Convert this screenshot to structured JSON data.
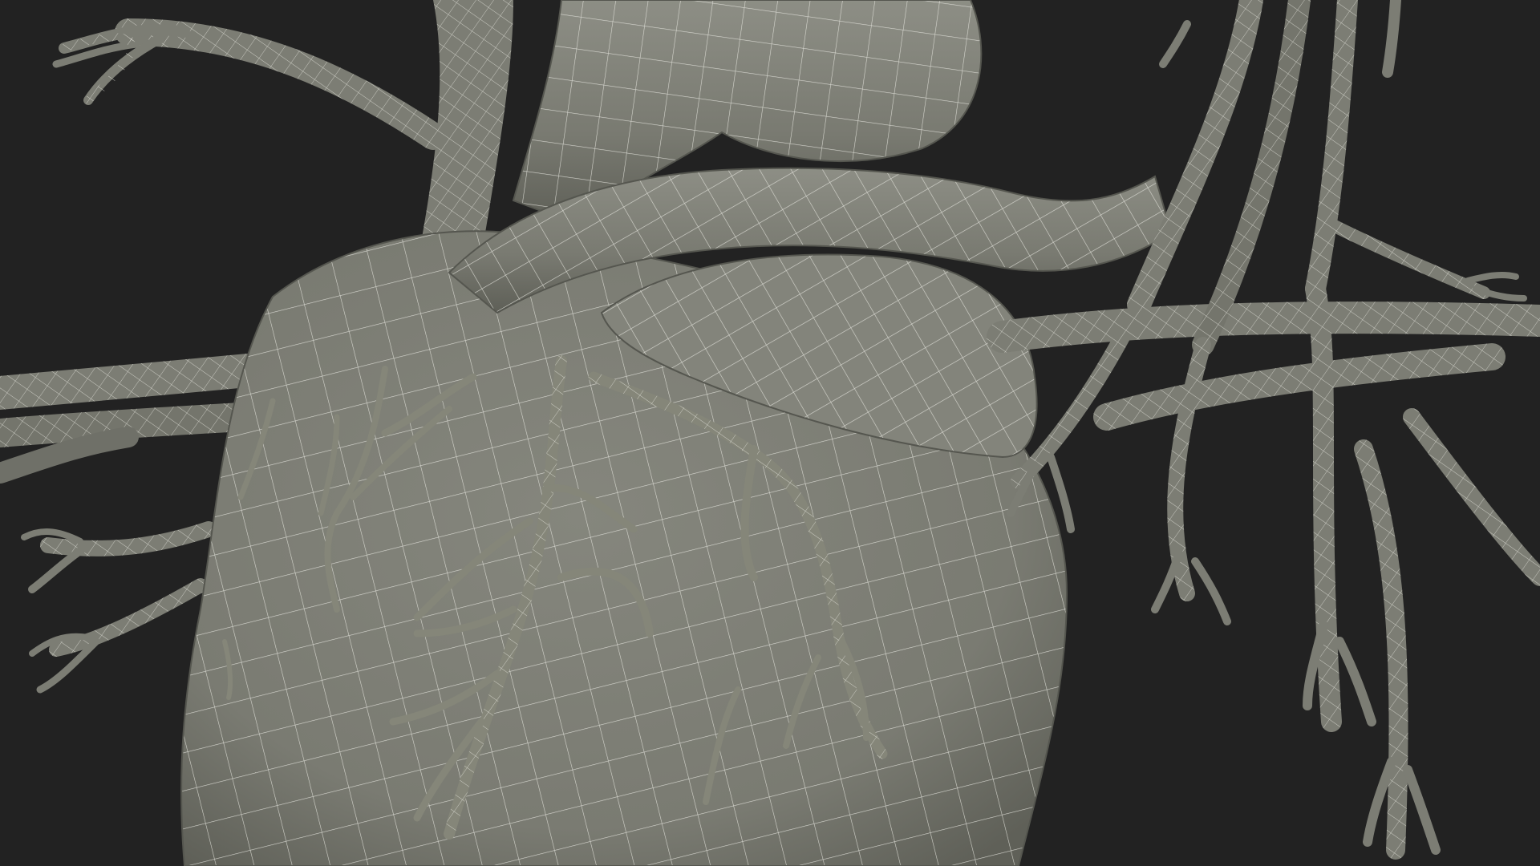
{
  "scene": {
    "subject": "heart-wireframe-model",
    "colors": {
      "background": "#222222",
      "surface": "#7c7d74",
      "surface_shadow": "#6b6c64",
      "surface_highlight": "#8a8b82",
      "wireframe": "#e6e6df"
    }
  }
}
